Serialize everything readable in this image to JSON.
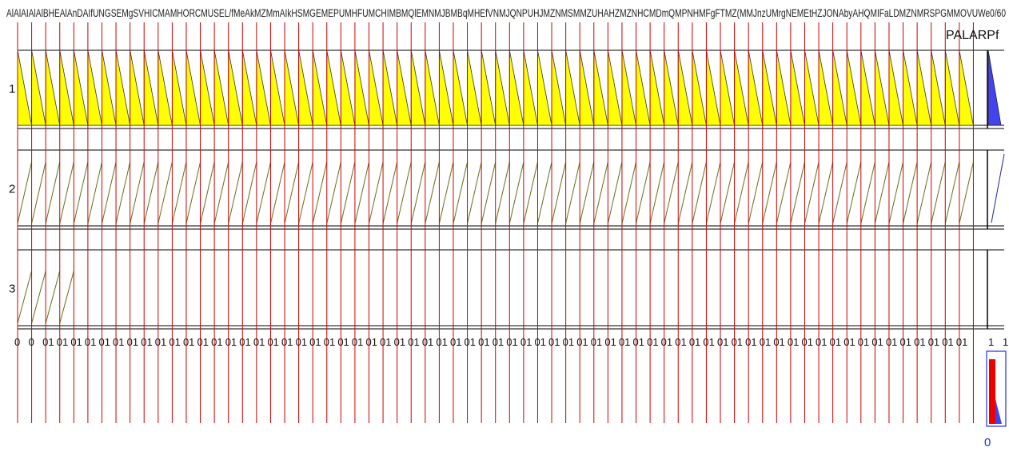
{
  "chart_data": {
    "type": "area",
    "header_text": "AlAlAIAlAlBHEAlAnDAIfUNGSEMgSVHICMAMHORCMUSEL/fMeAkMZMmAIkHSMGEMEPUMHFUMCHIMBMQlEMNMJBMBqMHEfVNMJQNPUHJMZNMSMMZUHAHZMZNHCMDmQMPNHMFgFTMZ(MMJnzUMrgNEMEtHZJONAbyAHQMIFaLDMZNMRSPGMMOVUWe0/60",
    "side_label": "PALARPf",
    "rows": [
      {
        "label": "1",
        "fill": "#ffff00",
        "stroke": "#333333"
      },
      {
        "label": "2",
        "fill": "none",
        "stroke": "#6b6b1a"
      },
      {
        "label": "3",
        "fill": "none",
        "stroke": "#6b6b1a"
      }
    ],
    "grid_color": "#cc0000",
    "accent_fill": "#4444ee",
    "indicator_color": "#ee0000",
    "column_count": 68,
    "row1": {
      "active_columns": 68,
      "peak": 1.0
    },
    "row2": {
      "active_columns": 68,
      "peak": 1.0
    },
    "row3": {
      "active_columns": 4,
      "peak": 0.85
    },
    "x_tick_labels": [
      "0",
      "0",
      "01",
      "01",
      "01",
      "01",
      "01",
      "01",
      "01",
      "01",
      "01",
      "01",
      "01",
      "01",
      "01",
      "01",
      "01",
      "01",
      "01",
      "01",
      "01",
      "01",
      "01",
      "01",
      "01",
      "01",
      "01",
      "01",
      "01",
      "01",
      "01",
      "01",
      "01",
      "01",
      "01",
      "01",
      "01",
      "01",
      "01",
      "01",
      "01",
      "01",
      "01",
      "01",
      "01",
      "01",
      "01",
      "01",
      "01",
      "01",
      "01",
      "01",
      "01",
      "01",
      "01",
      "01",
      "01",
      "01",
      "01",
      "01",
      "01",
      "01",
      "01",
      "01",
      "01",
      "01",
      "01",
      "01"
    ],
    "right_tick_labels": [
      "1",
      "1"
    ],
    "bottom_label": "0",
    "indicator_level": 0.92
  }
}
